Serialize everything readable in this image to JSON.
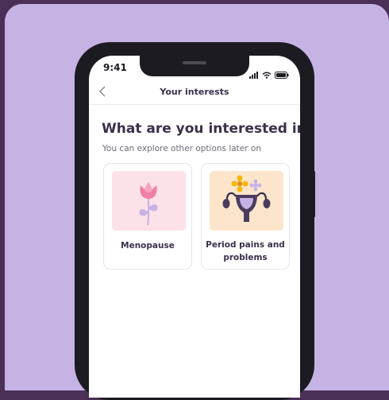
{
  "status_bar": {
    "time": "9:41"
  },
  "nav": {
    "back_icon": "chevron-left-icon",
    "title": "Your interests"
  },
  "main": {
    "heading": "What are you interested in?",
    "subheading": "You can explore other options later on",
    "cards": [
      {
        "label": "Menopause",
        "icon": "flower-icon",
        "bg": "#fce1e8"
      },
      {
        "label": "Period pains and problems",
        "icon": "uterus-icon",
        "bg": "#fde5cc"
      }
    ]
  },
  "colors": {
    "background": "#c5b3e3",
    "frame": "#4a2f57",
    "text": "#3b2f4b"
  }
}
